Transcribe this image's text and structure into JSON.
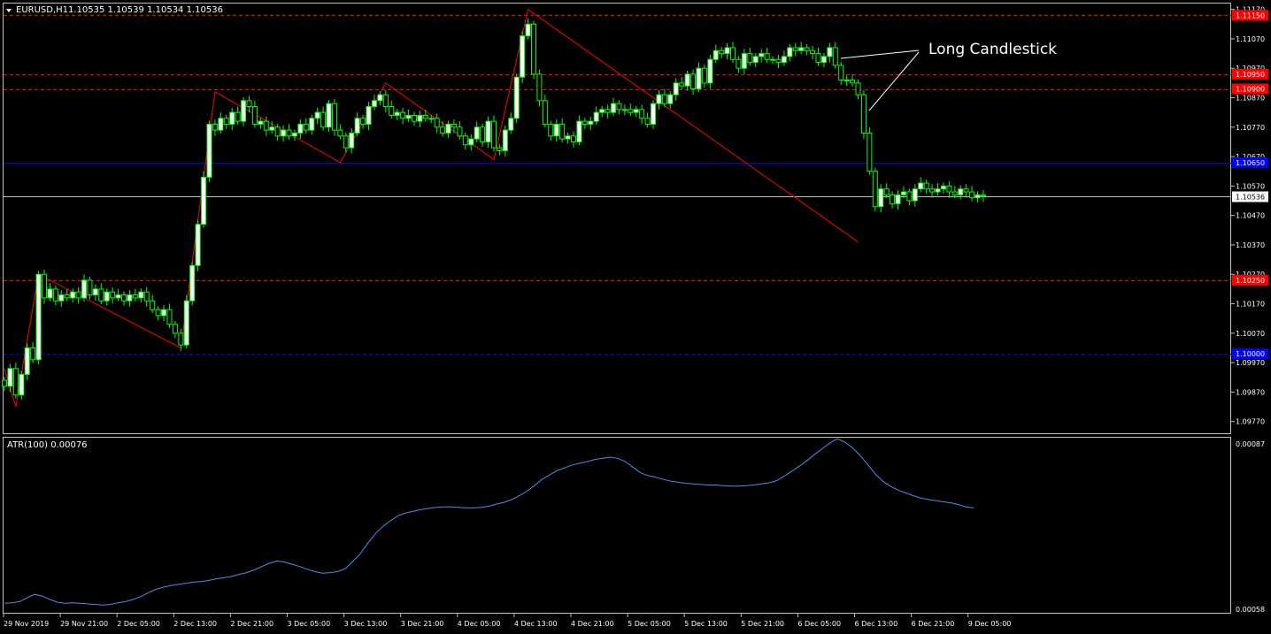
{
  "main": {
    "symbol_label": "EURUSD,H1",
    "ohlc": "1.10535 1.10539 1.10534 1.10536",
    "current_price": "1.10536",
    "price_min": 1.0973,
    "price_max": 1.1119,
    "annotation": "Long Candlestick",
    "axis_ticks": [
      "1.11170",
      "1.11070",
      "1.10970",
      "1.10870",
      "1.10770",
      "1.10670",
      "1.10570",
      "1.10470",
      "1.10370",
      "1.10270",
      "1.10170",
      "1.10070",
      "1.09970",
      "1.09870",
      "1.09770"
    ],
    "levels": [
      {
        "price": 1.1115,
        "label": "1.11150",
        "color": "#ff0000",
        "style": "dashed"
      },
      {
        "price": 1.1095,
        "label": "1.10950",
        "color": "#ff0000",
        "style": "dashed"
      },
      {
        "price": 1.109,
        "label": "1.10900",
        "color": "#ff0000",
        "style": "dashed"
      },
      {
        "price": 1.1065,
        "label": "1.10650",
        "color": "#0000ff",
        "style": "solid"
      },
      {
        "price": 1.1025,
        "label": "1.10250",
        "color": "#ff0000",
        "style": "dashed"
      },
      {
        "price": 1.1,
        "label": "1.10000",
        "color": "#0000ff",
        "style": "dashed"
      }
    ],
    "zigzag": [
      [
        0,
        1.0995
      ],
      [
        2,
        1.0982
      ],
      [
        6,
        1.1027
      ],
      [
        31,
        1.1002
      ],
      [
        37,
        1.1089
      ],
      [
        59,
        1.1065
      ],
      [
        67,
        1.1092
      ],
      [
        86,
        1.1066
      ],
      [
        92,
        1.1117
      ],
      [
        150,
        1.1038
      ]
    ],
    "candles": [
      {
        "c": 1.0989
      },
      {
        "c": 1.0995
      },
      {
        "c": 1.0986
      },
      {
        "c": 1.0993
      },
      {
        "c": 1.1002
      },
      {
        "c": 1.0998
      },
      {
        "c": 1.1027
      },
      {
        "c": 1.1019
      },
      {
        "c": 1.1022
      },
      {
        "c": 1.1018
      },
      {
        "c": 1.102
      },
      {
        "c": 1.1019
      },
      {
        "c": 1.1021
      },
      {
        "c": 1.1019
      },
      {
        "c": 1.1025
      },
      {
        "c": 1.102
      },
      {
        "c": 1.1022
      },
      {
        "c": 1.1018
      },
      {
        "c": 1.1021
      },
      {
        "c": 1.1019
      },
      {
        "c": 1.102
      },
      {
        "c": 1.1018
      },
      {
        "c": 1.102
      },
      {
        "c": 1.1019
      },
      {
        "c": 1.1021
      },
      {
        "c": 1.1018
      },
      {
        "c": 1.1015
      },
      {
        "c": 1.1013
      },
      {
        "c": 1.1015
      },
      {
        "c": 1.101
      },
      {
        "c": 1.1007
      },
      {
        "c": 1.1003
      },
      {
        "c": 1.1018
      },
      {
        "c": 1.103
      },
      {
        "c": 1.1044
      },
      {
        "c": 1.106
      },
      {
        "c": 1.1078
      },
      {
        "c": 1.1076
      },
      {
        "c": 1.108
      },
      {
        "c": 1.1078
      },
      {
        "c": 1.1082
      },
      {
        "c": 1.1079
      },
      {
        "c": 1.1086
      },
      {
        "c": 1.1084
      },
      {
        "c": 1.1078
      },
      {
        "c": 1.1079
      },
      {
        "c": 1.1076
      },
      {
        "c": 1.1077
      },
      {
        "c": 1.1074
      },
      {
        "c": 1.1076
      },
      {
        "c": 1.1074
      },
      {
        "c": 1.1075
      },
      {
        "c": 1.1078
      },
      {
        "c": 1.1076
      },
      {
        "c": 1.108
      },
      {
        "c": 1.1082
      },
      {
        "c": 1.1077
      },
      {
        "c": 1.1085
      },
      {
        "c": 1.1076
      },
      {
        "c": 1.1074
      },
      {
        "c": 1.107
      },
      {
        "c": 1.1075
      },
      {
        "c": 1.108
      },
      {
        "c": 1.1078
      },
      {
        "c": 1.1084
      },
      {
        "c": 1.1086
      },
      {
        "c": 1.1088
      },
      {
        "c": 1.1084
      },
      {
        "c": 1.1081
      },
      {
        "c": 1.1082
      },
      {
        "c": 1.108
      },
      {
        "c": 1.1081
      },
      {
        "c": 1.1079
      },
      {
        "c": 1.1081
      },
      {
        "c": 1.108
      },
      {
        "c": 1.108
      },
      {
        "c": 1.1077
      },
      {
        "c": 1.1075
      },
      {
        "c": 1.1078
      },
      {
        "c": 1.1077
      },
      {
        "c": 1.1074
      },
      {
        "c": 1.1071
      },
      {
        "c": 1.1073
      },
      {
        "c": 1.1077
      },
      {
        "c": 1.1072
      },
      {
        "c": 1.1079
      },
      {
        "c": 1.107
      },
      {
        "c": 1.1069
      },
      {
        "c": 1.1076
      },
      {
        "c": 1.108
      },
      {
        "c": 1.1094
      },
      {
        "c": 1.1108
      },
      {
        "c": 1.1112
      },
      {
        "c": 1.1095
      },
      {
        "c": 1.1086
      },
      {
        "c": 1.1078
      },
      {
        "c": 1.1074
      },
      {
        "c": 1.1078
      },
      {
        "c": 1.1073
      },
      {
        "c": 1.1074
      },
      {
        "c": 1.1072
      },
      {
        "c": 1.1079
      },
      {
        "c": 1.1078
      },
      {
        "c": 1.1079
      },
      {
        "c": 1.1082
      },
      {
        "c": 1.1083
      },
      {
        "c": 1.1082
      },
      {
        "c": 1.1085
      },
      {
        "c": 1.1083
      },
      {
        "c": 1.1083
      },
      {
        "c": 1.1082
      },
      {
        "c": 1.1083
      },
      {
        "c": 1.108
      },
      {
        "c": 1.1078
      },
      {
        "c": 1.1085
      },
      {
        "c": 1.1088
      },
      {
        "c": 1.1085
      },
      {
        "c": 1.1088
      },
      {
        "c": 1.1092
      },
      {
        "c": 1.1091
      },
      {
        "c": 1.1095
      },
      {
        "c": 1.109
      },
      {
        "c": 1.1097
      },
      {
        "c": 1.1092
      },
      {
        "c": 1.11
      },
      {
        "c": 1.1103
      },
      {
        "c": 1.1102
      },
      {
        "c": 1.1104
      },
      {
        "c": 1.11
      },
      {
        "c": 1.1097
      },
      {
        "c": 1.1102
      },
      {
        "c": 1.1099
      },
      {
        "c": 1.1101
      },
      {
        "c": 1.1102
      },
      {
        "c": 1.11
      },
      {
        "c": 1.11
      },
      {
        "c": 1.1099
      },
      {
        "c": 1.1101
      },
      {
        "c": 1.1104
      },
      {
        "c": 1.1103
      },
      {
        "c": 1.1104
      },
      {
        "c": 1.1103
      },
      {
        "c": 1.1102
      },
      {
        "c": 1.1099
      },
      {
        "c": 1.1101
      },
      {
        "c": 1.1104
      },
      {
        "c": 1.1098
      },
      {
        "c": 1.1093
      },
      {
        "c": 1.1093
      },
      {
        "c": 1.1092
      },
      {
        "c": 1.1088
      },
      {
        "c": 1.1075
      },
      {
        "c": 1.1062
      },
      {
        "c": 1.105
      },
      {
        "c": 1.1056
      },
      {
        "c": 1.1054
      },
      {
        "c": 1.1051
      },
      {
        "c": 1.1054
      },
      {
        "c": 1.1055
      },
      {
        "c": 1.1052
      },
      {
        "c": 1.1056
      },
      {
        "c": 1.1058
      },
      {
        "c": 1.1056
      },
      {
        "c": 1.1055
      },
      {
        "c": 1.1056
      },
      {
        "c": 1.1057
      },
      {
        "c": 1.1055
      },
      {
        "c": 1.1054
      },
      {
        "c": 1.1056
      },
      {
        "c": 1.1055
      },
      {
        "c": 1.1053
      },
      {
        "c": 1.1054
      },
      {
        "c": 1.10536
      }
    ]
  },
  "indicator": {
    "label": "ATR(100) 0.00076",
    "axis_top": "0.00087",
    "axis_bottom": "0.00058",
    "min": 0.00058,
    "max": 0.00087,
    "color": "#4a90e2",
    "values": [
      0.000589,
      0.00059,
      0.000592,
      0.000599,
      0.000605,
      0.000602,
      0.000596,
      0.000591,
      0.000589,
      0.00059,
      0.000589,
      0.000588,
      0.000587,
      0.000586,
      0.000587,
      0.00059,
      0.000592,
      0.000596,
      0.000601,
      0.000608,
      0.000614,
      0.000618,
      0.000621,
      0.000623,
      0.000625,
      0.000627,
      0.000628,
      0.00063,
      0.000633,
      0.000635,
      0.000637,
      0.000641,
      0.000644,
      0.000649,
      0.000655,
      0.000661,
      0.000665,
      0.000663,
      0.000659,
      0.000655,
      0.00065,
      0.000646,
      0.000643,
      0.000644,
      0.000646,
      0.000651,
      0.000664,
      0.000678,
      0.000697,
      0.000714,
      0.000727,
      0.000737,
      0.000746,
      0.000751,
      0.000754,
      0.000757,
      0.000759,
      0.000761,
      0.000762,
      0.000762,
      0.000761,
      0.00076,
      0.00076,
      0.000761,
      0.000763,
      0.000767,
      0.00077,
      0.000775,
      0.000782,
      0.00079,
      0.0008,
      0.000811,
      0.000819,
      0.000827,
      0.000832,
      0.000837,
      0.00084,
      0.000843,
      0.000847,
      0.000849,
      0.000851,
      0.000849,
      0.000843,
      0.000833,
      0.000823,
      0.000818,
      0.000815,
      0.000811,
      0.000808,
      0.000806,
      0.000804,
      0.000803,
      0.000802,
      0.000801,
      0.000801,
      0.0008,
      0.000799,
      0.000799,
      0.0008,
      0.000801,
      0.000803,
      0.000805,
      0.000809,
      0.000817,
      0.000826,
      0.000835,
      0.000845,
      0.000856,
      0.000866,
      0.000876,
      0.000884,
      0.000878,
      0.000868,
      0.000854,
      0.000838,
      0.000821,
      0.000808,
      0.000799,
      0.000792,
      0.000787,
      0.000782,
      0.000778,
      0.000775,
      0.000773,
      0.000771,
      0.000769,
      0.000766,
      0.000762,
      0.00076
    ]
  },
  "time_axis": [
    "29 Nov 2019",
    "29 Nov 21:00",
    "2 Dec 05:00",
    "2 Dec 13:00",
    "2 Dec 21:00",
    "3 Dec 05:00",
    "3 Dec 13:00",
    "3 Dec 21:00",
    "4 Dec 05:00",
    "4 Dec 13:00",
    "4 Dec 21:00",
    "5 Dec 05:00",
    "5 Dec 13:00",
    "5 Dec 21:00",
    "6 Dec 05:00",
    "6 Dec 13:00",
    "6 Dec 21:00",
    "9 Dec 05:00"
  ],
  "colors": {
    "bull": "#ffffff",
    "bear": "#000000",
    "wick": "#00ff00",
    "zigzag": "#ff0000",
    "frame": "#c0c0c0",
    "current_line": "#c0c0c0"
  }
}
